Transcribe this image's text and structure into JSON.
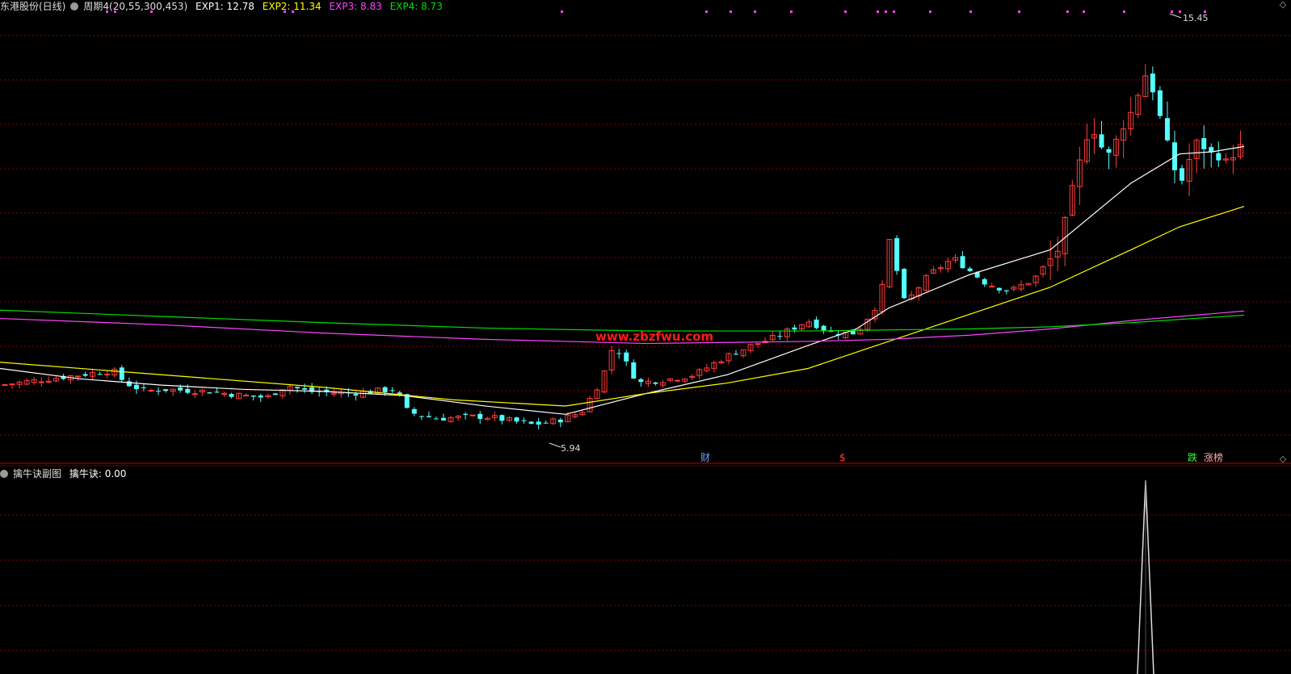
{
  "main_header": {
    "stock": "东港股份(日线)",
    "indicator": "周期4(20,55,300,453)",
    "exp": [
      {
        "label": "EXP1",
        "value": "12.78",
        "color": "#ffffff"
      },
      {
        "label": "EXP2",
        "value": "11.34",
        "color": "#ffff00"
      },
      {
        "label": "EXP3",
        "value": "8.83",
        "color": "#ff44ff"
      },
      {
        "label": "EXP4",
        "value": "8.73",
        "color": "#00e000"
      }
    ]
  },
  "sub_header": {
    "name": "擒牛诀副图",
    "label": "擒牛诀",
    "value": "0.00"
  },
  "watermark": "www.zbzfwu.com",
  "annotations": {
    "high_label": "15.45",
    "low_label": "5.94",
    "marker_cai": "财",
    "marker_dollar": "$",
    "marker_die": "跌",
    "marker_zhangbang": "涨榜"
  },
  "colors": {
    "up": "#ff3c3c",
    "down": "#54ffff",
    "grid": "#8a0000",
    "ma1": "#ffffff",
    "ma2": "#ffff00",
    "ma3": "#ff44ff",
    "ma4": "#00e000"
  },
  "icons": [
    "settings-circle-icon",
    "diamond-icon"
  ],
  "chart_data": [
    {
      "type": "candlestick",
      "title": "东港股份(日线)",
      "y_range": [
        5.4,
        16.0
      ],
      "series": [
        {
          "name": "EXP1",
          "last": 12.78
        },
        {
          "name": "EXP2",
          "last": 11.34
        },
        {
          "name": "EXP3",
          "last": 8.83
        },
        {
          "name": "EXP4",
          "last": 8.73
        }
      ],
      "annotations": [
        {
          "text": "15.45",
          "value": 15.45,
          "kind": "high"
        },
        {
          "text": "5.94",
          "value": 5.94,
          "kind": "low"
        }
      ]
    },
    {
      "type": "line",
      "title": "擒牛诀副图",
      "y_range": [
        0,
        1
      ],
      "series": [
        {
          "name": "擒牛诀",
          "last": 0.0
        }
      ]
    }
  ]
}
